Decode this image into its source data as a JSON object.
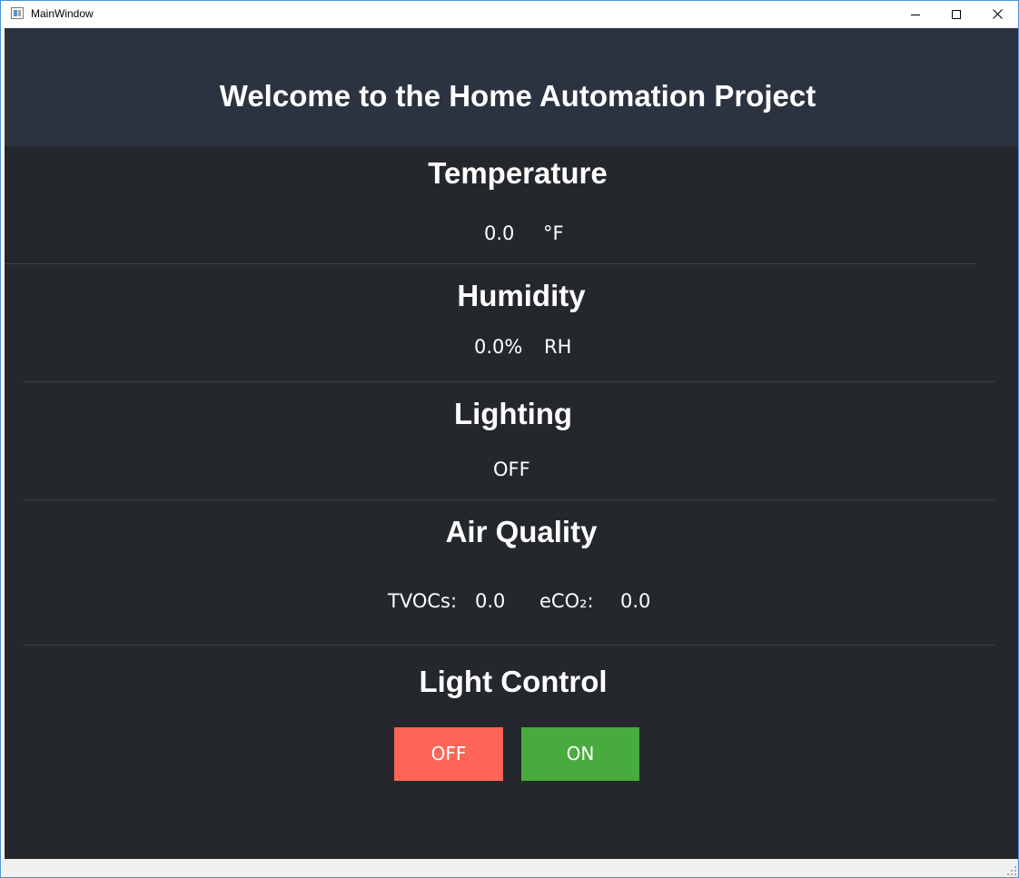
{
  "window": {
    "title": "MainWindow",
    "controls": {
      "minimize": "minimize-icon",
      "maximize": "maximize-icon",
      "close": "close-icon"
    }
  },
  "header": {
    "title": "Welcome to the Home Automation Project"
  },
  "temperature": {
    "heading": "Temperature",
    "value": "0.0",
    "unit": "°F"
  },
  "humidity": {
    "heading": "Humidity",
    "value": "0.0%",
    "unit": "RH"
  },
  "lighting": {
    "heading": "Lighting",
    "status": "OFF"
  },
  "air_quality": {
    "heading": "Air Quality",
    "tvoc_label": "TVOCs:",
    "tvoc_value": "0.0",
    "eco2_label": "eCO₂:",
    "eco2_value": "0.0"
  },
  "light_control": {
    "heading": "Light Control",
    "off_label": "OFF",
    "on_label": "ON"
  },
  "colors": {
    "header_background": "#2c3340",
    "body_background": "#24282c",
    "off_button": "#ff6557",
    "on_button": "#48ab3d",
    "text": "#ffffff"
  }
}
